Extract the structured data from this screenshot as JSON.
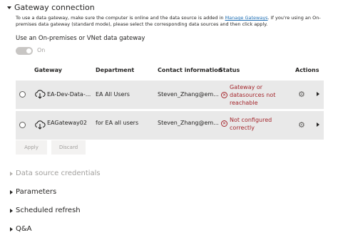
{
  "gateway_connection": {
    "title": "Gateway connection",
    "description_part1": "To use a data gateway, make sure the computer is online and the data source is added in ",
    "description_link": "Manage Gateways",
    "description_part2": ". If you're using an On-premises data gateway (standard mode), please select the corresponding data sources and then click apply.",
    "toggle_label": "Use an On-premises or VNet data gateway",
    "toggle_state": "On",
    "columns": [
      "Gateway",
      "Department",
      "Contact information",
      "Status",
      "Actions"
    ],
    "rows": [
      {
        "gateway": "EA-Dev-Data-...",
        "department": "EA All Users",
        "contact": "Steven_Zhang@em...",
        "status": "Gateway or datasources not reachable"
      },
      {
        "gateway": "EAGateway02",
        "department": "for EA all users",
        "contact": "Steven_Zhang@em...",
        "status": "Not configured correctly"
      }
    ],
    "apply_label": "Apply",
    "discard_label": "Discard"
  },
  "sections": {
    "data_source_credentials": "Data source credentials",
    "parameters": "Parameters",
    "scheduled_refresh": "Scheduled refresh",
    "qna": "Q&A"
  },
  "colors": {
    "error": "#a4262c",
    "link": "#1f6fb5",
    "row_bg": "#e9e9e9"
  }
}
